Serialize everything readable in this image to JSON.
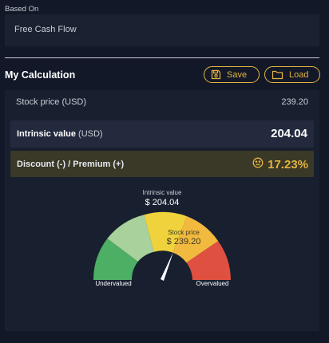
{
  "based_on": {
    "label": "Based On",
    "value": "Free Cash Flow"
  },
  "calculation": {
    "title": "My Calculation",
    "save_label": "Save",
    "load_label": "Load",
    "stock_price_label": "Stock price (USD)",
    "stock_price_value": "239.20",
    "intrinsic_label": "Intrinsic value",
    "intrinsic_unit": "(USD)",
    "intrinsic_value": "204.04",
    "discount_label": "Discount (-) / Premium (+)",
    "discount_value": "17.23%",
    "discount_icon": "sad-face-icon"
  },
  "gauge": {
    "intrinsic_caption": "Intrinsic value",
    "intrinsic_amount": "$ 204.04",
    "stock_caption": "Stock price",
    "stock_amount": "$ 239.20",
    "left_label": "Undervalued",
    "right_label": "Overvalued",
    "segment_colors": [
      "#4caf63",
      "#a9d19b",
      "#f0d33c",
      "#f2b93f",
      "#e05040"
    ],
    "accent": "#e3b341"
  }
}
